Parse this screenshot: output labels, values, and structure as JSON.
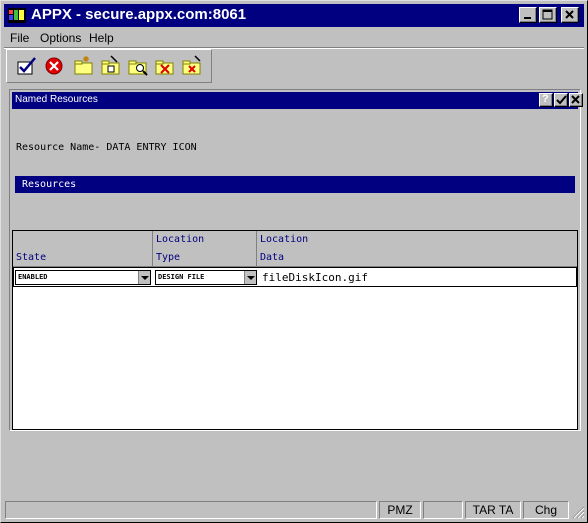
{
  "window": {
    "title": "APPX - secure.appx.com:8061",
    "controls": {
      "minimize": "minimize-icon",
      "maximize": "maximize-icon",
      "close": "close-icon"
    }
  },
  "menu": [
    {
      "label": "File"
    },
    {
      "label": "Options"
    },
    {
      "label": "Help"
    }
  ],
  "toolbar": [
    {
      "icon": "checkmark-icon"
    },
    {
      "icon": "cancel-icon"
    },
    {
      "icon": "folder-new-icon"
    },
    {
      "icon": "folder-edit-icon"
    },
    {
      "icon": "folder-search-icon"
    },
    {
      "icon": "folder-delete-icon"
    },
    {
      "icon": "folder-remove-icon"
    }
  ],
  "child_window": {
    "title": "Named Resources",
    "controls": {
      "help": "?",
      "ok": "ok-icon",
      "close": "close-icon"
    }
  },
  "resource": {
    "label": "Resource Name-",
    "value": "DATA ENTRY ICON"
  },
  "section_title": "Resources",
  "columns": [
    {
      "line1": "",
      "line2": "State"
    },
    {
      "line1": "Location",
      "line2": "Type"
    },
    {
      "line1": "Location",
      "line2": "Data"
    }
  ],
  "rows": [
    {
      "state": "ENABLED",
      "location_type": "DESIGN FILE",
      "location_data": "fileDiskIcon.gif"
    }
  ],
  "status": {
    "pane_2": "PMZ",
    "pane_4": "TAR TA",
    "pane_5": "Chg"
  },
  "colors": {
    "titlebar": "#000080",
    "face": "#c0c0c0",
    "header_text": "#000080"
  }
}
